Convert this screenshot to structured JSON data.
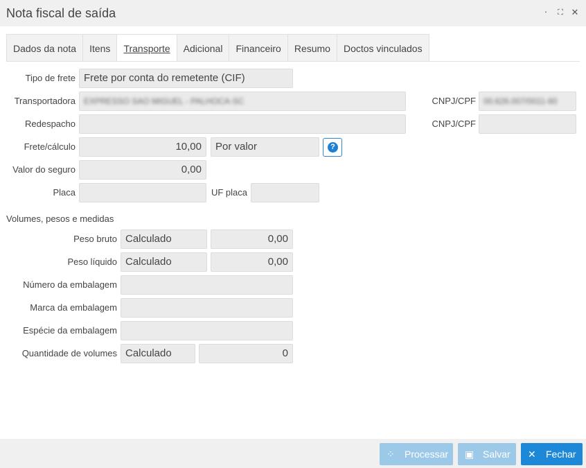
{
  "window": {
    "title": "Nota fiscal de saída",
    "minimize_icon": "⋅",
    "maximize_icon": "⛶",
    "close_icon": "✕"
  },
  "tabs": [
    {
      "label": "Dados da nota"
    },
    {
      "label": "Itens"
    },
    {
      "label": "Transporte",
      "active": true
    },
    {
      "label": "Adicional"
    },
    {
      "label": "Financeiro"
    },
    {
      "label": "Resumo"
    },
    {
      "label": "Doctos vinculados"
    }
  ],
  "transporte": {
    "tipo_frete_label": "Tipo de frete",
    "tipo_frete_value": "Frete por conta do remetente (CIF)",
    "transportadora_label": "Transportadora",
    "transportadora_value": "EXPRESSO SAO MIGUEL - PALHOCA-SC",
    "cnpj_label": "CNPJ/CPF",
    "cnpj_value": "00.626.007/0011-60",
    "redespacho_label": "Redespacho",
    "redespacho_value": "",
    "cnpj2_label": "CNPJ/CPF",
    "cnpj2_value": "",
    "frete_label": "Frete/cálculo",
    "frete_value": "10,00",
    "frete_calc_value": "Por valor",
    "help_icon": "?",
    "seguro_label": "Valor do seguro",
    "seguro_value": "0,00",
    "placa_label": "Placa",
    "placa_value": "",
    "uf_placa_label": "UF placa",
    "uf_placa_value": ""
  },
  "volumes": {
    "section_title": "Volumes, pesos e medidas",
    "peso_bruto_label": "Peso bruto",
    "peso_bruto_mode": "Calculado",
    "peso_bruto_value": "0,00",
    "peso_liquido_label": "Peso líquido",
    "peso_liquido_mode": "Calculado",
    "peso_liquido_value": "0,00",
    "numero_embalagem_label": "Número da embalagem",
    "numero_embalagem_value": "",
    "marca_embalagem_label": "Marca da embalagem",
    "marca_embalagem_value": "",
    "especie_embalagem_label": "Espécie da embalagem",
    "especie_embalagem_value": "",
    "quantidade_label": "Quantidade de volumes",
    "quantidade_mode": "Calculado",
    "quantidade_value": "0"
  },
  "footer": {
    "processar_label": "Processar",
    "processar_icon": "⁘",
    "salvar_label": "Salvar",
    "salvar_icon": "▣",
    "fechar_label": "Fechar",
    "fechar_icon": "✕"
  }
}
